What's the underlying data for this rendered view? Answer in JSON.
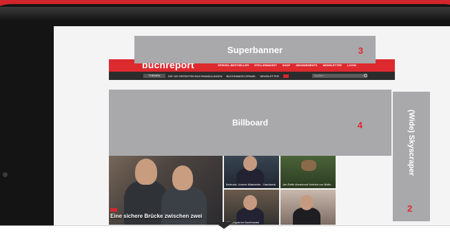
{
  "ads": {
    "superbanner": {
      "label": "Superbanner",
      "number": "3"
    },
    "billboard": {
      "label": "Billboard",
      "number": "4"
    },
    "skyscraper": {
      "label": "(Wide) Skyscraper",
      "number": "2"
    }
  },
  "site": {
    "logo": "buchreport",
    "nav": [
      "SPIEGEL-BESTSELLER",
      "STELLENMARKT",
      "SHOP",
      "ABONNEMENTS",
      "NEWSLETTER",
      "LOGIN"
    ],
    "themen": "THEMEN",
    "sub_links": [
      "DIE 100 GRÖSSTEN BUCHHANDLUNGEN",
      "BUCHHANDELSPANEL",
      "NEWSLETTER"
    ],
    "search_placeholder": "Suchen...",
    "main_headline": "Eine sichere Brücke zwischen zwei",
    "card_texts": [
      "Bethusis: Unsere Mitarbeiter - Handwerk",
      "Jan Raffe übernimmt Vertrieb von Bollin",
      "Hilfsprogramm Buchhandel",
      ""
    ]
  },
  "colors": {
    "brand_red": "#dd2a2f",
    "ad_gray": "#a9a9ac",
    "ad_number_red": "#e3262d"
  }
}
